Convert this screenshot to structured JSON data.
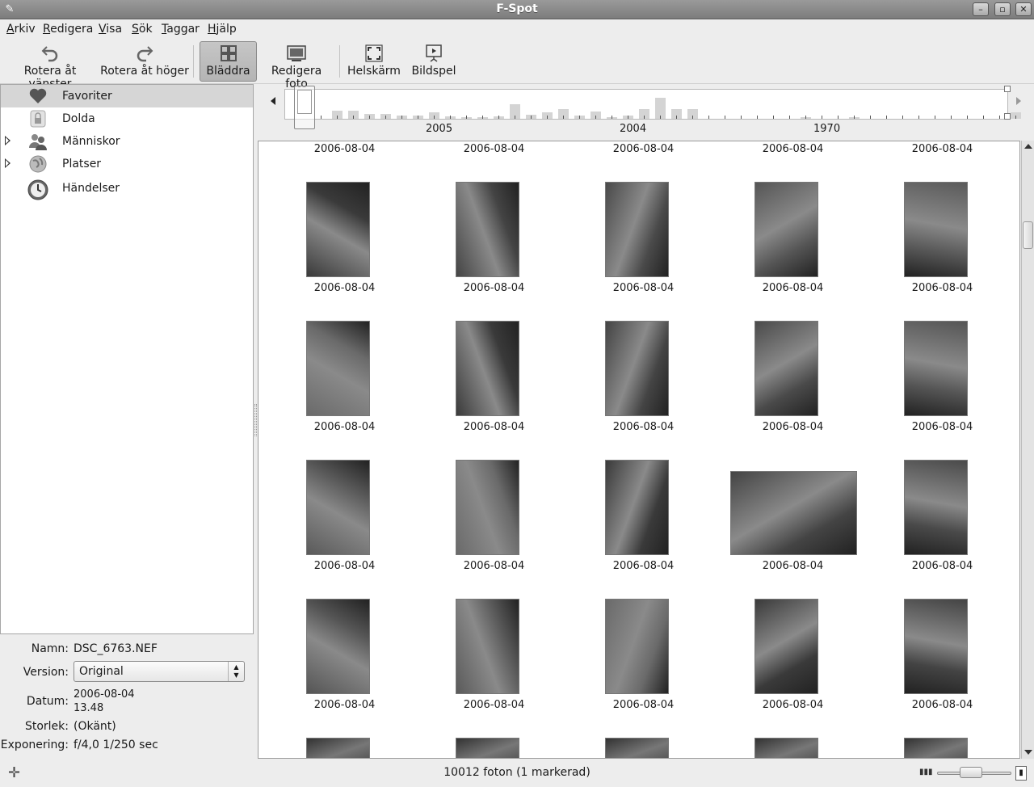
{
  "window": {
    "title": "F-Spot"
  },
  "menu": [
    "Arkiv",
    "Redigera",
    "Visa",
    "Sök",
    "Taggar",
    "Hjälp"
  ],
  "menu_underline": [
    "A",
    "R",
    "V",
    "S",
    "T",
    "H"
  ],
  "menu_rest": [
    "rkiv",
    "edigera",
    "isa",
    "ök",
    "aggar",
    "jälp"
  ],
  "toolbar": {
    "rotate_left": "Rotera åt vänster",
    "rotate_right": "Rotera åt höger",
    "browse": "Bläddra",
    "edit_photo": "Redigera foto",
    "fullscreen": "Helskärm",
    "slideshow": "Bildspel"
  },
  "sidebar": {
    "items": [
      {
        "label": "Favoriter",
        "icon": "heart-icon",
        "selected": true,
        "expandable": false
      },
      {
        "label": "Dolda",
        "icon": "lock-icon",
        "selected": false,
        "expandable": false
      },
      {
        "label": "Människor",
        "icon": "people-icon",
        "selected": false,
        "expandable": true
      },
      {
        "label": "Platser",
        "icon": "globe-icon",
        "selected": false,
        "expandable": true
      },
      {
        "label": "Händelser",
        "icon": "clock-icon",
        "selected": false,
        "expandable": false
      }
    ]
  },
  "info": {
    "name_label": "Namn:",
    "name_value": "DSC_6763.NEF",
    "version_label": "Version:",
    "version_value": "Original",
    "date_label": "Datum:",
    "date_value_1": "2006-08-04",
    "date_value_2": "13.48",
    "size_label": "Storlek:",
    "size_value": "(Okänt)",
    "exposure_label": "Exponering:",
    "exposure_value": "f/4,0 1/250 sec"
  },
  "timeline": {
    "years": [
      "2005",
      "2004",
      "1970"
    ]
  },
  "grid": {
    "top_dates": [
      "2006-08-04",
      "2006-08-04",
      "2006-08-04",
      "2006-08-04",
      "2006-08-04"
    ],
    "rows": [
      [
        "2006-08-04",
        "2006-08-04",
        "2006-08-04",
        "2006-08-04",
        "2006-08-04"
      ],
      [
        "2006-08-04",
        "2006-08-04",
        "2006-08-04",
        "2006-08-04",
        "2006-08-04"
      ],
      [
        "2006-08-04",
        "2006-08-04",
        "2006-08-04",
        "2006-08-04",
        "2006-08-04"
      ],
      [
        "2006-08-04",
        "2006-08-04",
        "2006-08-04",
        "2006-08-04",
        "2006-08-04"
      ]
    ]
  },
  "status": {
    "count": "10012 foton (1 markerad)"
  }
}
